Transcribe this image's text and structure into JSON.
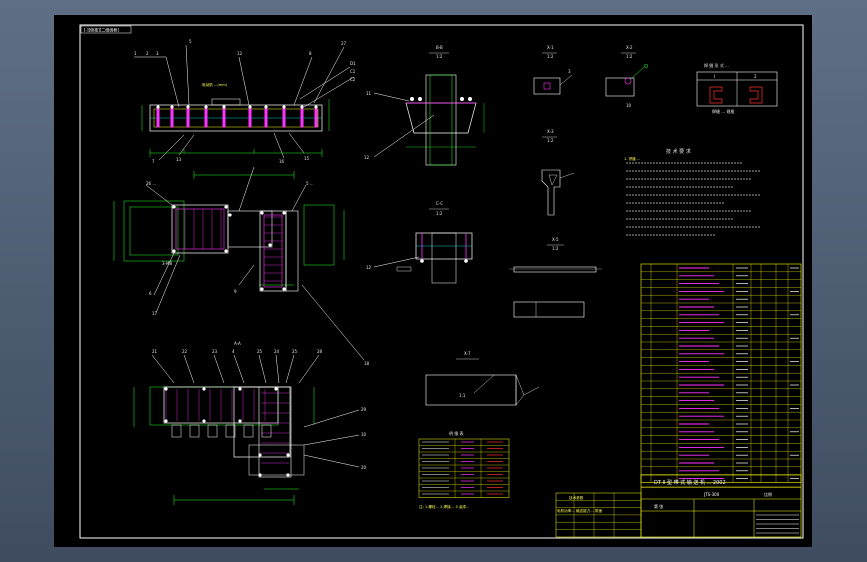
{
  "viewport": {
    "background_top": "#5f6f86",
    "background_bottom": "#3f4c60",
    "paper": "#000000"
  },
  "drawing": {
    "frame_tag": "[-][俯视][二维线框]",
    "view_labels": [
      "B-B",
      "1:2",
      "A-A",
      "C-C"
    ],
    "notes_title": "技 术 要 求",
    "notes_line1": "1. 拼缝 ...",
    "title_block_label": "DT II 型 带 式 输 送 机 ... 2002",
    "drawing_no": "JTS-300",
    "scale_text": "比例",
    "sheet_text": "第 张",
    "table_header": "明 细 表",
    "parts_count": 28
  },
  "colors": {
    "outline": "#ffffff",
    "yellow": "#ffff00",
    "green": "#22ff22",
    "cyan": "#00ffff",
    "magenta": "#ff33ff",
    "red": "#ff3030"
  }
}
